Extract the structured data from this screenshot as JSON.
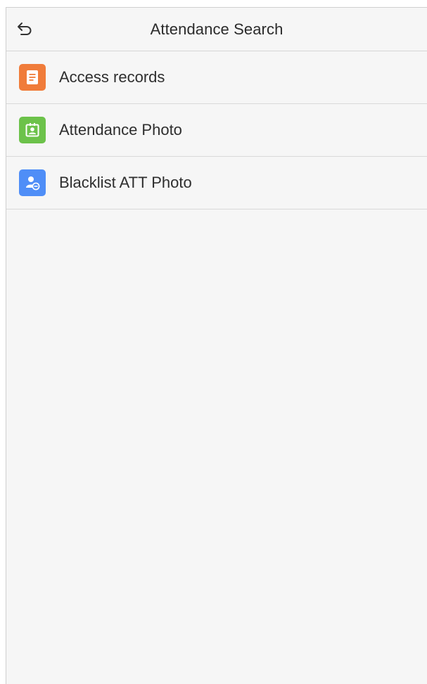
{
  "header": {
    "title": "Attendance Search",
    "back_icon": "back-arrow-icon"
  },
  "menu": {
    "items": [
      {
        "label": "Access records",
        "icon": "document-icon",
        "color": "#f07c3a"
      },
      {
        "label": "Attendance Photo",
        "icon": "id-card-icon",
        "color": "#6cc24a"
      },
      {
        "label": "Blacklist ATT Photo",
        "icon": "user-blocked-icon",
        "color": "#4f8ef7"
      }
    ]
  },
  "colors": {
    "background": "#f6f6f6",
    "divider": "#d9d9d9",
    "text": "#2e2e2e"
  }
}
